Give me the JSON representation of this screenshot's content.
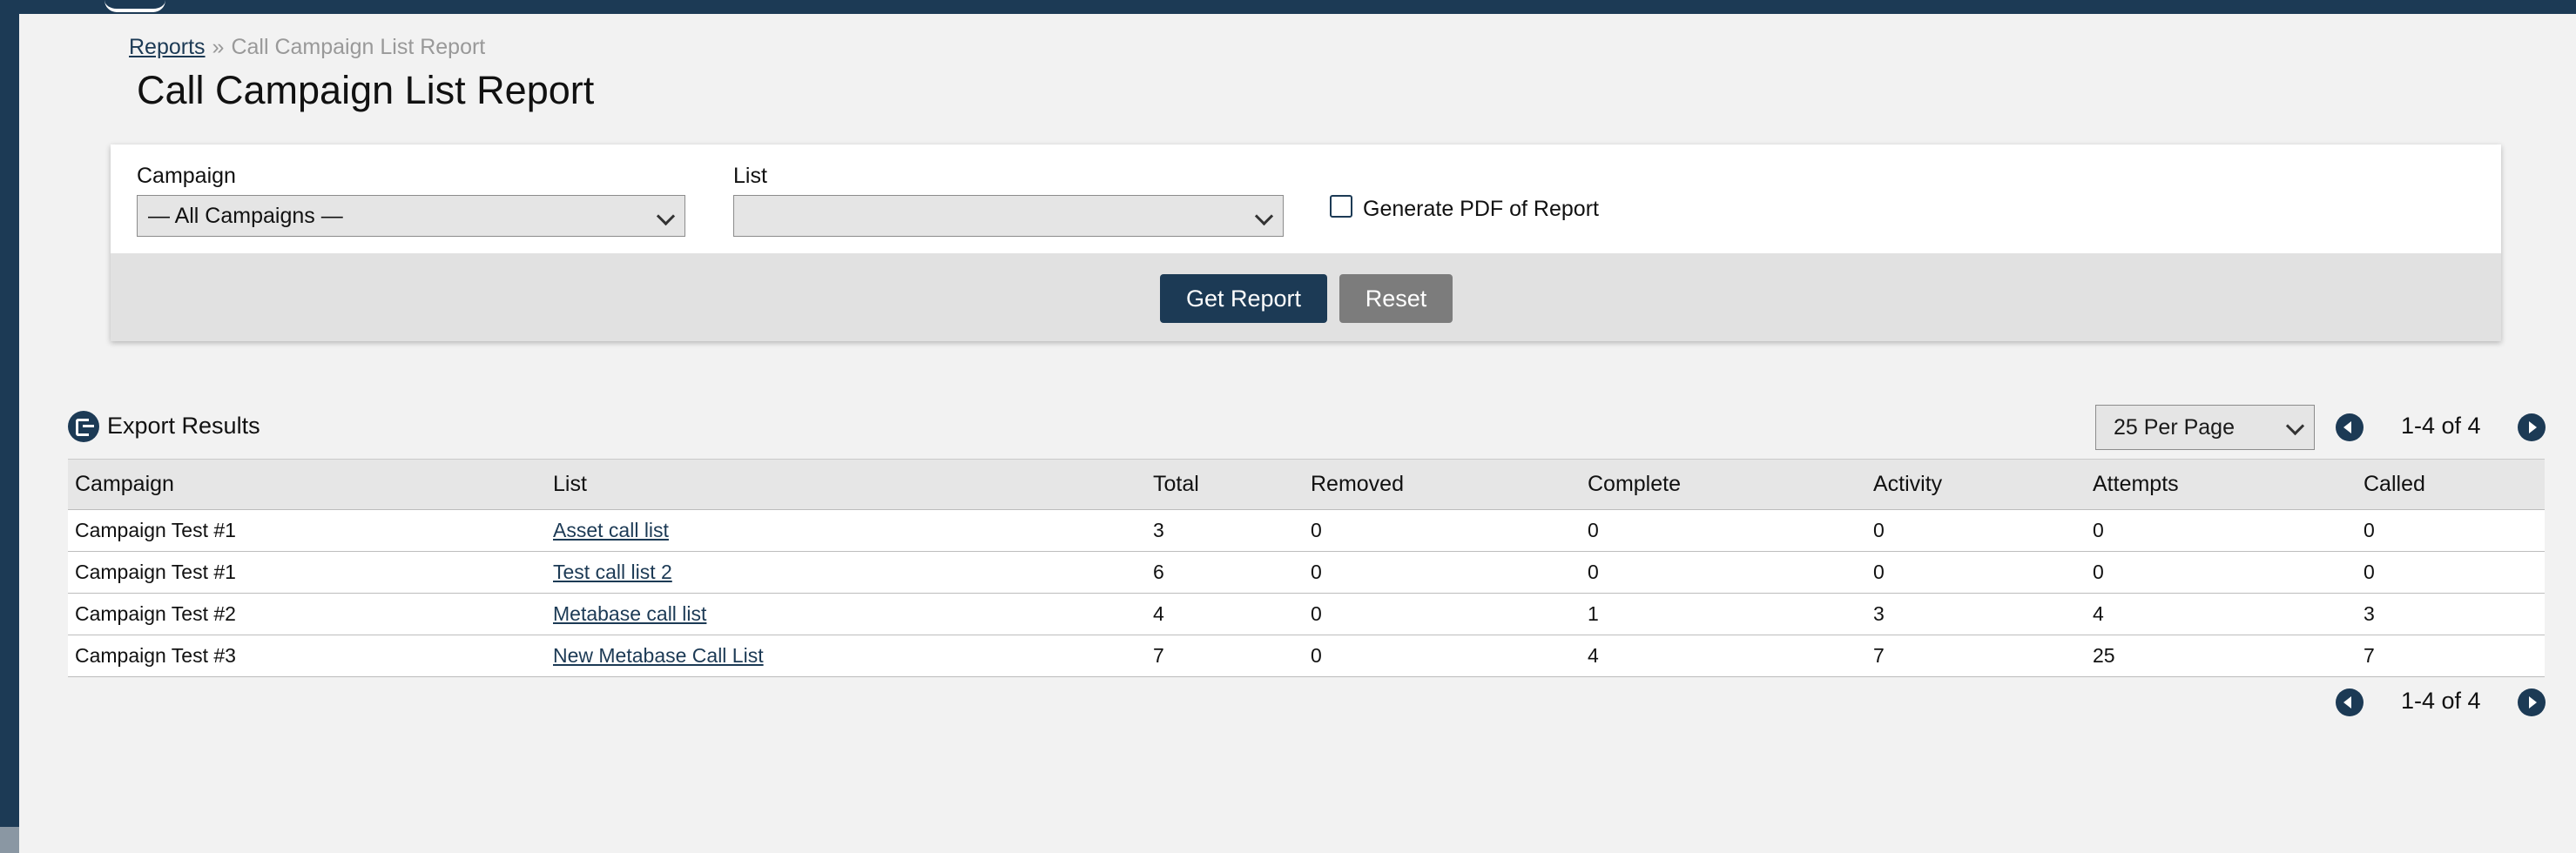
{
  "breadcrumb": {
    "root": "Reports",
    "separator": "»",
    "current": "Call Campaign List Report"
  },
  "page_title": "Call Campaign List Report",
  "filters": {
    "campaign_label": "Campaign",
    "campaign_value": "— All Campaigns —",
    "list_label": "List",
    "list_value": "",
    "pdf_label": "Generate PDF of Report",
    "pdf_checked": false,
    "get_report": "Get Report",
    "reset": "Reset"
  },
  "toolbar": {
    "export": "Export Results",
    "per_page": "25 Per Page",
    "range": "1-4 of 4"
  },
  "table": {
    "columns": [
      "Campaign",
      "List",
      "Total",
      "Removed",
      "Complete",
      "Activity",
      "Attempts",
      "Called"
    ],
    "rows": [
      [
        "Campaign Test #1",
        "Asset call list",
        "3",
        "0",
        "0",
        "0",
        "0",
        "0"
      ],
      [
        "Campaign Test #1",
        "Test call list 2",
        "6",
        "0",
        "0",
        "0",
        "0",
        "0"
      ],
      [
        "Campaign Test #2",
        "Metabase call list",
        "4",
        "0",
        "1",
        "3",
        "4",
        "3"
      ],
      [
        "Campaign Test #3",
        "New Metabase Call List",
        "7",
        "0",
        "4",
        "7",
        "25",
        "7"
      ]
    ]
  },
  "colors": {
    "brand": "#1c3a55",
    "secondary": "#7c7c7c"
  },
  "icons": {
    "export": "export-icon",
    "prev": "chevron-left-icon",
    "next": "chevron-right-icon",
    "dropdown": "chevron-down-icon"
  }
}
